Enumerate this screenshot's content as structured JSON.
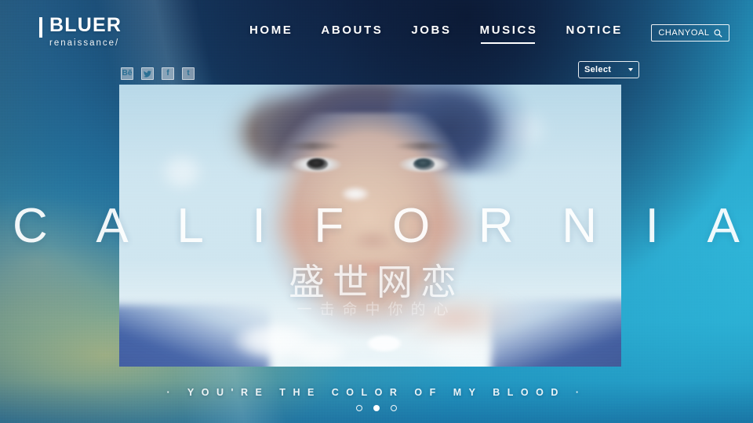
{
  "site": {
    "logo_name": "BLUER",
    "logo_sub": "renaissance/"
  },
  "nav": {
    "items": [
      {
        "label": "HOME",
        "active": false
      },
      {
        "label": "ABOUTS",
        "active": false
      },
      {
        "label": "JOBS",
        "active": false
      },
      {
        "label": "MUSICS",
        "active": true
      },
      {
        "label": "NOTICE",
        "active": false
      }
    ]
  },
  "search": {
    "value": "CHANYOAL",
    "placeholder": "CHANYOAL",
    "icon": "search-icon"
  },
  "select": {
    "label": "Select",
    "icon": "chevron-down-icon",
    "options": [
      "Select"
    ]
  },
  "social": {
    "items": [
      {
        "name": "behance-icon",
        "glyph": "Bē"
      },
      {
        "name": "twitter-icon",
        "glyph": "ᴡ"
      },
      {
        "name": "facebook-icon",
        "glyph": "f"
      },
      {
        "name": "tumblr-icon",
        "glyph": "t"
      }
    ]
  },
  "hero": {
    "headline": "CALIFORNIA",
    "headline_letters": [
      "C",
      "A",
      "L",
      "I",
      "F",
      "O",
      "R",
      "N",
      "I",
      "A"
    ],
    "cjk_title": "盛世网恋",
    "cjk_subtitle": "一击命中你的心",
    "tagline": "·  YOU'RE  THE  COLOR  OF  MY  BLOOD  ·"
  },
  "carousel": {
    "slides": 3,
    "active_index": 1,
    "dots": [
      {
        "label": "slide-1",
        "active": false
      },
      {
        "label": "slide-2",
        "active": true
      },
      {
        "label": "slide-3",
        "active": false
      }
    ]
  },
  "colors": {
    "cyan": "#29b2d6",
    "navy": "#1a2a4a",
    "white": "#ffffff",
    "warm": "#d6c470",
    "photo_pale": "#c2dfeb"
  }
}
